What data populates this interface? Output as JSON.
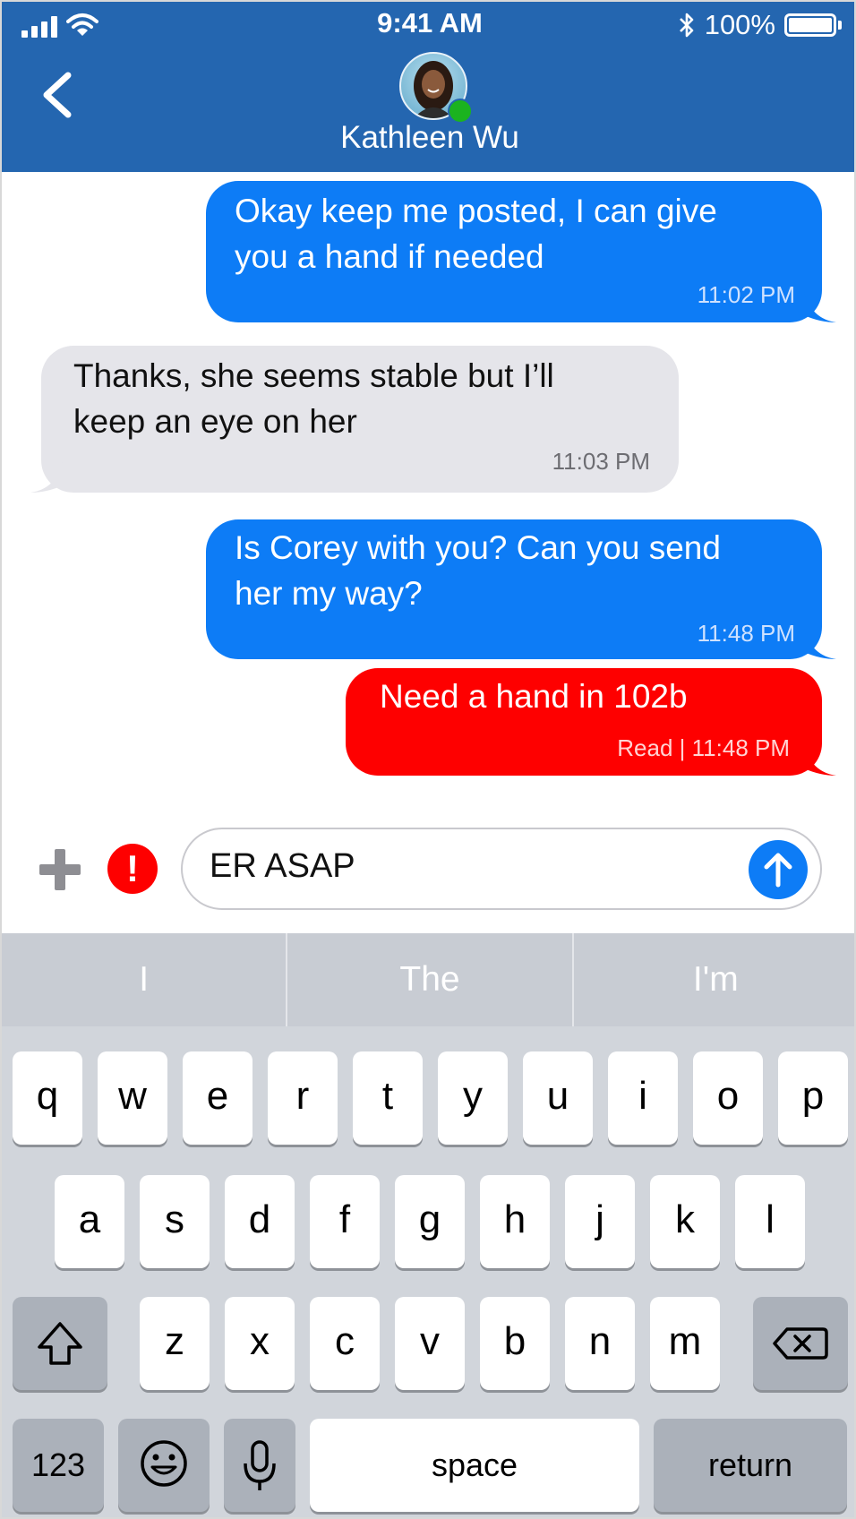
{
  "status_bar": {
    "time": "9:41 AM",
    "battery_percent": "100%",
    "battery_level": 1.0,
    "signal_icon": "signal-icon",
    "wifi_icon": "wifi-icon",
    "bluetooth_icon": "bluetooth-icon"
  },
  "header": {
    "back_icon": "chevron-left-icon",
    "contact_name": "Kathleen Wu",
    "presence_status_color": "#1bb31f"
  },
  "messages": [
    {
      "direction": "outgoing",
      "text": "Okay keep me posted, I can give\nyou a hand if needed",
      "time": "11:02 PM",
      "color": "#0d7cf6"
    },
    {
      "direction": "incoming",
      "text": "Thanks, she seems stable but I’ll\nkeep an eye on her",
      "time": "11:03 PM",
      "color": "#e5e5ea"
    },
    {
      "direction": "outgoing",
      "text": "Is Corey with you? Can you send\nher my way?",
      "time": "11:48 PM",
      "color": "#0d7cf6"
    },
    {
      "direction": "outgoing",
      "priority": "urgent",
      "text": "Need a hand in 102b",
      "time": "Read | 11:48 PM",
      "color": "#fe0000"
    }
  ],
  "composer": {
    "attach_icon": "plus-icon",
    "priority_icon": "exclamation-icon",
    "input_value": "ER ASAP",
    "send_icon": "arrow-up-icon"
  },
  "keyboard": {
    "suggestions": [
      "I",
      "The",
      "I'm"
    ],
    "row1": [
      "q",
      "w",
      "e",
      "r",
      "t",
      "y",
      "u",
      "i",
      "o",
      "p"
    ],
    "row2": [
      "a",
      "s",
      "d",
      "f",
      "g",
      "h",
      "j",
      "k",
      "l"
    ],
    "row3": [
      "z",
      "x",
      "c",
      "v",
      "b",
      "n",
      "m"
    ],
    "shift_icon": "shift-icon",
    "delete_icon": "backspace-icon",
    "numbers_label": "123",
    "emoji_icon": "emoji-icon",
    "mic_icon": "microphone-icon",
    "space_label": "space",
    "return_label": "return"
  }
}
